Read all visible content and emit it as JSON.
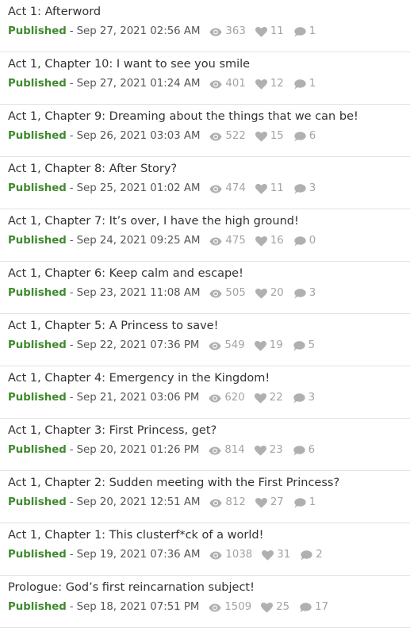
{
  "icons": {
    "views": "eye-icon",
    "likes": "heart-icon",
    "comments": "comment-icon",
    "stat_color": "#b0b0b0",
    "published_color": "#3f8a2e"
  },
  "chapters": [
    {
      "title": "Act 1: Afterword",
      "status": "Published",
      "separator": "-",
      "date": "Sep 27, 2021 02:56 AM",
      "views": "363",
      "likes": "11",
      "comments": "1"
    },
    {
      "title": "Act 1, Chapter 10: I want to see you smile",
      "status": "Published",
      "separator": "-",
      "date": "Sep 27, 2021 01:24 AM",
      "views": "401",
      "likes": "12",
      "comments": "1"
    },
    {
      "title": "Act 1, Chapter 9: Dreaming about the things that we can be!",
      "status": "Published",
      "separator": "-",
      "date": "Sep 26, 2021 03:03 AM",
      "views": "522",
      "likes": "15",
      "comments": "6"
    },
    {
      "title": "Act 1, Chapter 8: After Story?",
      "status": "Published",
      "separator": "-",
      "date": "Sep 25, 2021 01:02 AM",
      "views": "474",
      "likes": "11",
      "comments": "3"
    },
    {
      "title": "Act 1, Chapter 7: It’s over, I have the high ground!",
      "status": "Published",
      "separator": "-",
      "date": "Sep 24, 2021 09:25 AM",
      "views": "475",
      "likes": "16",
      "comments": "0"
    },
    {
      "title": "Act 1, Chapter 6: Keep calm and escape!",
      "status": "Published",
      "separator": "-",
      "date": "Sep 23, 2021 11:08 AM",
      "views": "505",
      "likes": "20",
      "comments": "3"
    },
    {
      "title": "Act 1, Chapter 5: A Princess to save!",
      "status": "Published",
      "separator": "-",
      "date": "Sep 22, 2021 07:36 PM",
      "views": "549",
      "likes": "19",
      "comments": "5"
    },
    {
      "title": "Act 1, Chapter 4: Emergency in the Kingdom!",
      "status": "Published",
      "separator": "-",
      "date": "Sep 21, 2021 03:06 PM",
      "views": "620",
      "likes": "22",
      "comments": "3"
    },
    {
      "title": "Act 1, Chapter 3: First Princess, get?",
      "status": "Published",
      "separator": "-",
      "date": "Sep 20, 2021 01:26 PM",
      "views": "814",
      "likes": "23",
      "comments": "6"
    },
    {
      "title": "Act 1, Chapter 2: Sudden meeting with the First Princess?",
      "status": "Published",
      "separator": "-",
      "date": "Sep 20, 2021 12:51 AM",
      "views": "812",
      "likes": "27",
      "comments": "1"
    },
    {
      "title": "Act 1, Chapter 1: This clusterf*ck of a world!",
      "status": "Published",
      "separator": "-",
      "date": "Sep 19, 2021 07:36 AM",
      "views": "1038",
      "likes": "31",
      "comments": "2"
    },
    {
      "title": "Prologue: God’s first reincarnation subject!",
      "status": "Published",
      "separator": "-",
      "date": "Sep 18, 2021 07:51 PM",
      "views": "1509",
      "likes": "25",
      "comments": "17"
    }
  ]
}
